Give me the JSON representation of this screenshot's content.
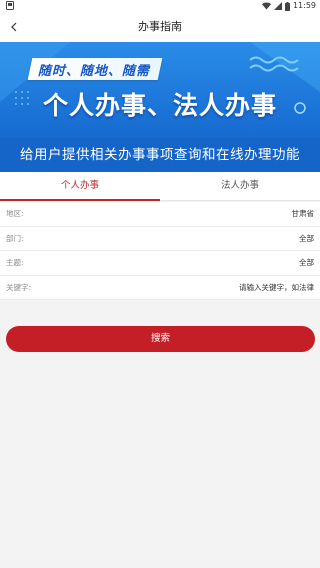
{
  "status_bar": {
    "time": "11:59"
  },
  "header": {
    "title": "办事指南"
  },
  "banner": {
    "ribbon_text": "随时、随地、随需",
    "headline": "个人办事、法人办事",
    "subline": "给用户提供相关办事事项查询和在线办理功能"
  },
  "tabs": [
    {
      "label": "个人办事",
      "active": true
    },
    {
      "label": "法人办事",
      "active": false
    }
  ],
  "form": {
    "rows": [
      {
        "label": "地区:",
        "value": "甘肃省"
      },
      {
        "label": "部门:",
        "value": "全部"
      },
      {
        "label": "主题:",
        "value": "全部"
      },
      {
        "label": "关键字:",
        "value": "请输入关键字，如法律"
      }
    ]
  },
  "search_button": {
    "label": "搜索"
  },
  "colors": {
    "accent": "#c41e26",
    "banner_blue": "#1b72d6"
  }
}
